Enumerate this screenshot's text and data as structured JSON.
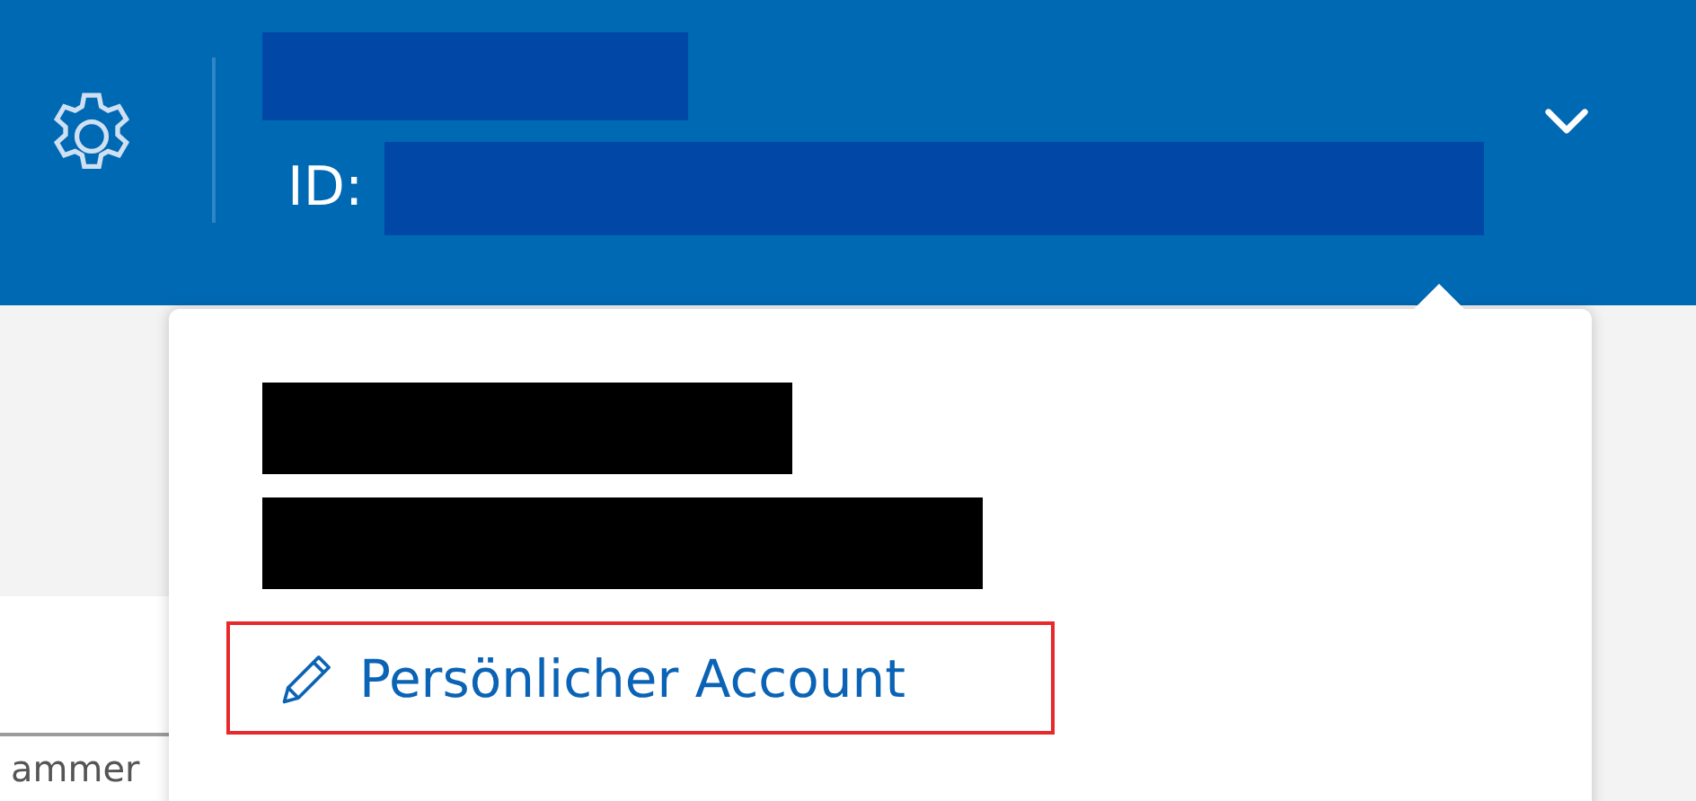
{
  "header": {
    "id_label": "ID:"
  },
  "dropdown": {
    "link": "Persönlicher Account",
    "link_highlighted": true
  },
  "background": {
    "text": "ammer"
  }
}
